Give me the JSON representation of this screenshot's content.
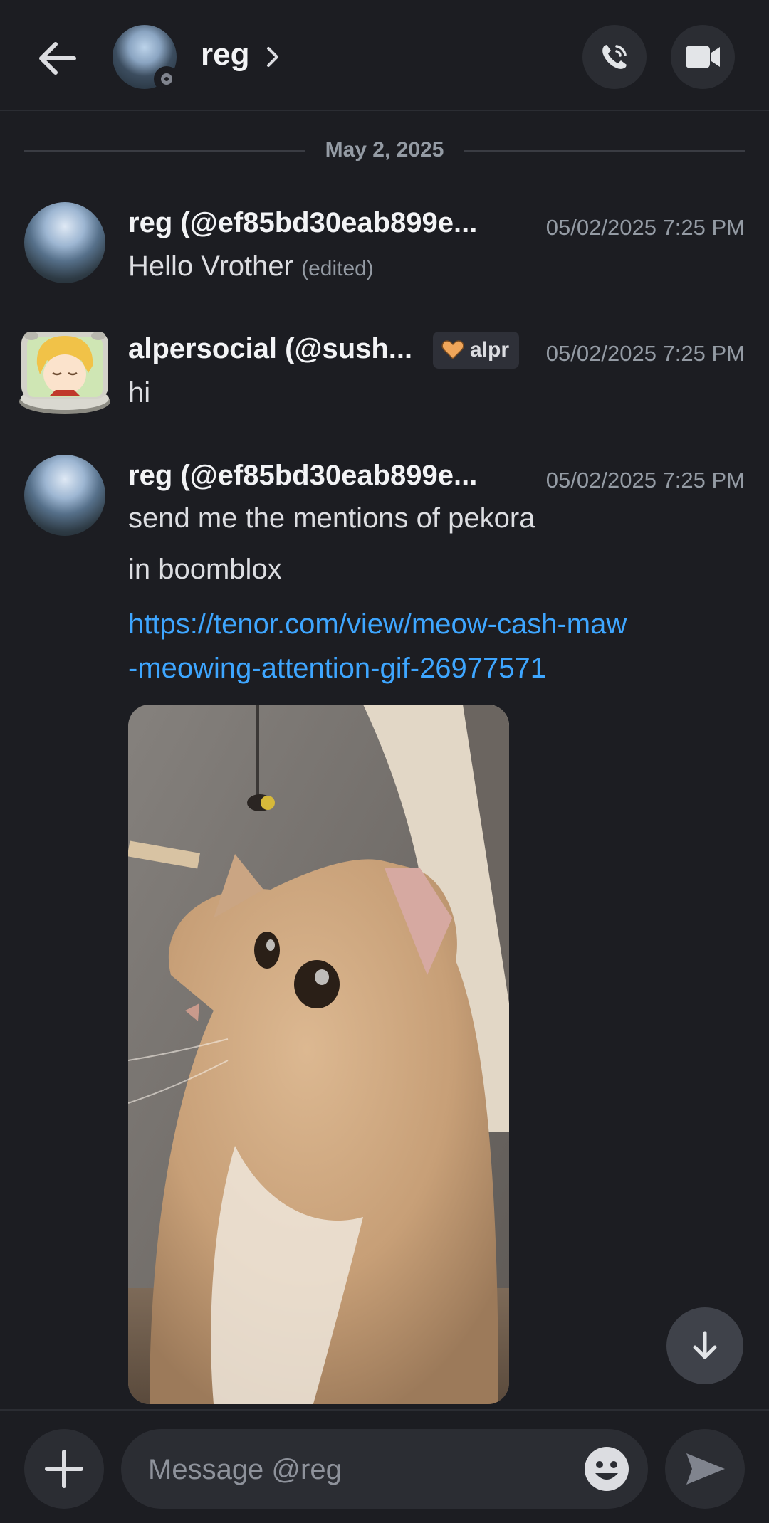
{
  "header": {
    "name": "reg"
  },
  "date_separator": "May 2, 2025",
  "messages": [
    {
      "author": "reg (@ef85bd30eab899e...",
      "timestamp": "05/02/2025 7:25 PM",
      "lines": [
        "Hello Vrother"
      ],
      "edited_label": "(edited)"
    },
    {
      "author": "alpersocial (@sush...",
      "tag": "alpr",
      "timestamp": "05/02/2025 7:25 PM",
      "lines": [
        "hi"
      ]
    },
    {
      "author": "reg (@ef85bd30eab899e...",
      "timestamp": "05/02/2025 7:25 PM",
      "lines": [
        "send me the mentions of pekora",
        "in boomblox"
      ],
      "link_lines": [
        "https://tenor.com/view/meow-cash-maw",
        "-meowing-attention-gif-26977571"
      ]
    }
  ],
  "composer": {
    "placeholder": "Message @reg"
  },
  "colors": {
    "background": "#1c1d22",
    "link": "#3ea6ff",
    "surface": "#2b2d33"
  }
}
